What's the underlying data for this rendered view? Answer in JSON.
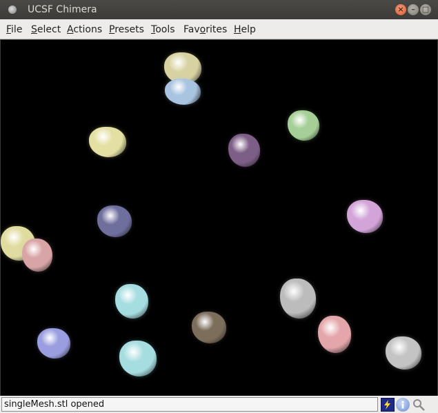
{
  "window": {
    "title": "UCSF Chimera"
  },
  "menubar": {
    "items": [
      {
        "pre": "",
        "u": "F",
        "post": "ile"
      },
      {
        "pre": "",
        "u": "S",
        "post": "elect"
      },
      {
        "pre": "",
        "u": "A",
        "post": "ctions"
      },
      {
        "pre": "",
        "u": "P",
        "post": "resets"
      },
      {
        "pre": "",
        "u": "T",
        "post": "ools"
      },
      {
        "pre": "Fav",
        "u": "o",
        "post": "rites"
      },
      {
        "pre": "",
        "u": "H",
        "post": "elp"
      }
    ]
  },
  "viewport": {
    "background": "#000000",
    "molecules": [
      {
        "color": "#d8d2a2"
      },
      {
        "color": "#a9c4e0"
      },
      {
        "color": "#a6cf98"
      },
      {
        "color": "#e4e0a4"
      },
      {
        "color": "#7d5e86"
      },
      {
        "color": "#d2a4d8"
      },
      {
        "color": "#6f6f9e"
      },
      {
        "color": "#e0dca0"
      },
      {
        "color": "#d9a4a6"
      },
      {
        "color": "#a6dde0"
      },
      {
        "color": "#bcbcbc"
      },
      {
        "color": "#7d6e5c"
      },
      {
        "color": "#9a9ee0"
      },
      {
        "color": "#a6dde0"
      },
      {
        "color": "#e4a6aa"
      },
      {
        "color": "#c4c4c4"
      }
    ]
  },
  "statusbar": {
    "message": "singleMesh.stl opened",
    "icons": [
      "lightning-icon",
      "info-icon",
      "magnifier-icon"
    ]
  }
}
